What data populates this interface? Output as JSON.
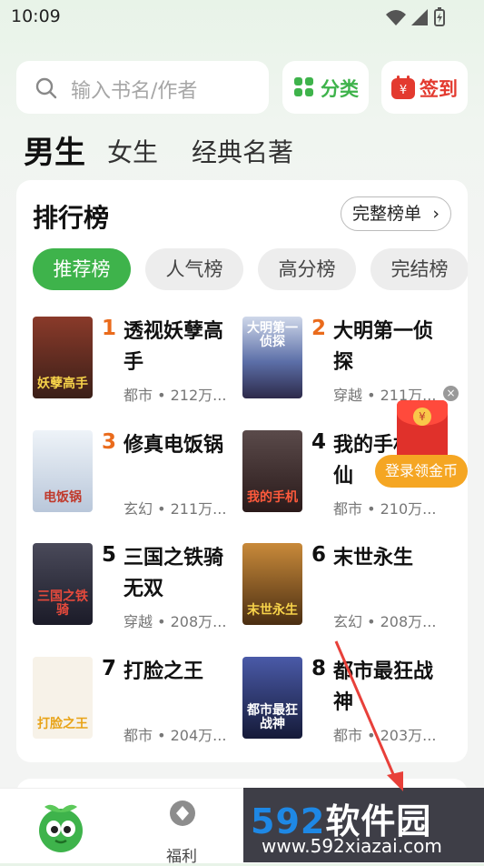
{
  "status_bar": {
    "time": "10:09"
  },
  "search": {
    "placeholder": "输入书名/作者"
  },
  "top_buttons": {
    "category": "分类",
    "sign_in": "签到"
  },
  "gender_tabs": [
    "男生",
    "女生",
    "经典名著"
  ],
  "ranking": {
    "title": "排行榜",
    "full_list": "完整榜单",
    "tabs": [
      "推荐榜",
      "人气榜",
      "高分榜",
      "完结榜"
    ],
    "books": [
      {
        "rank": "1",
        "title": "透视妖孽高手",
        "meta": "都市 • 212万...",
        "cover_text": "妖孽高手",
        "cover_color": "#5a2a1f"
      },
      {
        "rank": "2",
        "title": "大明第一侦探",
        "meta": "穿越 • 211万...",
        "cover_text": "大明第一侦探",
        "cover_color": "#5c6fa8"
      },
      {
        "rank": "3",
        "title": "修真电饭锅",
        "meta": "玄幻 • 211万...",
        "cover_text": "电饭锅",
        "cover_color": "#d8e2ee"
      },
      {
        "rank": "4",
        "title": "我的手机神仙",
        "meta": "都市 • 210万...",
        "cover_text": "我的手机",
        "cover_color": "#3b2a2a"
      },
      {
        "rank": "5",
        "title": "三国之铁骑无双",
        "meta": "穿越 • 208万...",
        "cover_text": "三国之铁骑",
        "cover_color": "#2b2b3b"
      },
      {
        "rank": "6",
        "title": "末世永生",
        "meta": "玄幻 • 208万...",
        "cover_text": "末世永生",
        "cover_color": "#6b4a22"
      },
      {
        "rank": "7",
        "title": "打脸之王",
        "meta": "都市 • 204万...",
        "cover_text": "打脸之王",
        "cover_color": "#f7f2e8"
      },
      {
        "rank": "8",
        "title": "都市最狂战神",
        "meta": "都市 • 203万...",
        "cover_text": "都市最狂战神",
        "cover_color": "#27305a"
      }
    ]
  },
  "promo": {
    "login_coin": "登录领金币",
    "coin_symbol": "¥"
  },
  "bottom_nav": {
    "fuli": "福利"
  },
  "watermark": {
    "big_num": "592",
    "big_text": "软件园",
    "url": "www.592xiazai.com"
  },
  "colors": {
    "accent_green": "#3eb34b",
    "rank_orange": "#ea6b1c",
    "promo_red": "#e0312b",
    "promo_orange": "#f5a623"
  }
}
